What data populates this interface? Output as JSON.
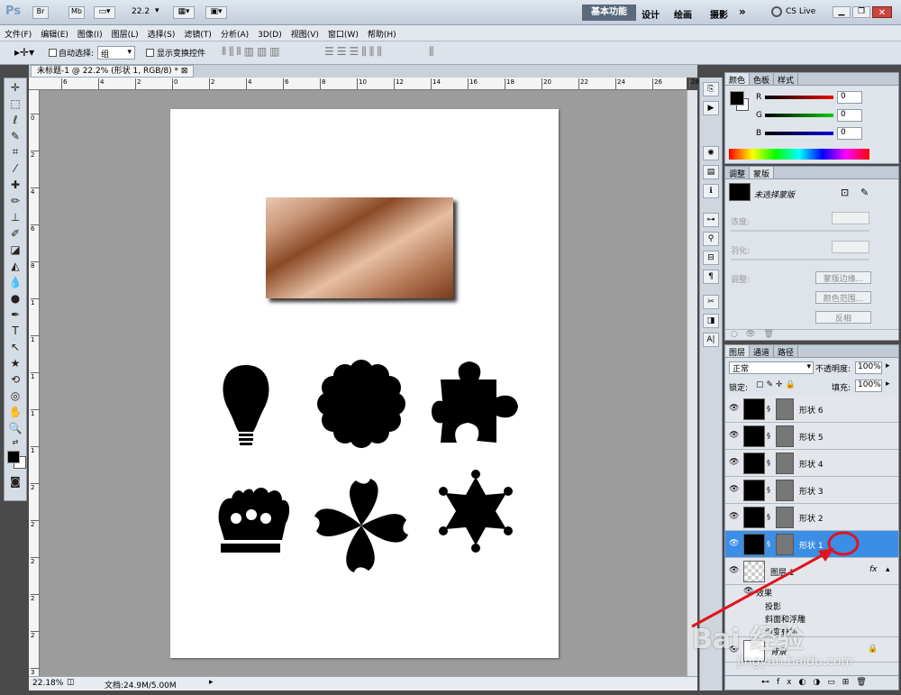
{
  "app": {
    "logo": "Ps",
    "bridge": "Br",
    "minibridge": "Mb",
    "zoom": "22.2",
    "workspaces": [
      "基本功能",
      "设计",
      "绘画",
      "摄影"
    ],
    "more": "»",
    "cslive": "CS Live"
  },
  "menu": [
    "文件(F)",
    "编辑(E)",
    "图像(I)",
    "图层(L)",
    "选择(S)",
    "滤镜(T)",
    "分析(A)",
    "3D(D)",
    "视图(V)",
    "窗口(W)",
    "帮助(H)"
  ],
  "options": {
    "autoselect_label": "自动选择:",
    "autoselect_value": "组",
    "transform_label": "显示变换控件"
  },
  "document": {
    "tab_title": "未标题-1 @ 22.2% (形状 1, RGB/8) *",
    "status_zoom": "22.18%",
    "status_doc": "文档:24.9M/5.00M",
    "ruler_top": [
      "6",
      "4",
      "2",
      "0",
      "2",
      "4",
      "6",
      "8",
      "10",
      "12",
      "14",
      "16",
      "18",
      "20",
      "22",
      "24",
      "26",
      "28"
    ],
    "ruler_left": [
      "0",
      "2",
      "4",
      "6",
      "8",
      "1",
      "1",
      "1",
      "1",
      "1",
      "2",
      "2",
      "2",
      "2",
      "2",
      "3"
    ]
  },
  "color_panel": {
    "tabs": [
      "颜色",
      "色板",
      "样式"
    ],
    "r_label": "R",
    "r_value": "0",
    "g_label": "G",
    "g_value": "0",
    "b_label": "B",
    "b_value": "0"
  },
  "adjust_panel": {
    "tabs": [
      "调整",
      "蒙版"
    ],
    "no_mask": "未选择蒙版",
    "density": "浓度:",
    "feather": "羽化:",
    "refine": "调整:",
    "mask_edge": "蒙版边缘...",
    "color_range": "颜色范围...",
    "invert": "反相"
  },
  "layers_panel": {
    "tabs": [
      "图层",
      "通道",
      "路径"
    ],
    "blend": "正常",
    "opacity_label": "不透明度:",
    "opacity": "100%",
    "lock_label": "锁定:",
    "fill_label": "填充:",
    "fill": "100%",
    "layers": [
      {
        "name": "形状 6",
        "selected": false
      },
      {
        "name": "形状 5",
        "selected": false
      },
      {
        "name": "形状 4",
        "selected": false
      },
      {
        "name": "形状 3",
        "selected": false
      },
      {
        "name": "形状 2",
        "selected": false
      },
      {
        "name": "形状 1",
        "selected": true
      }
    ],
    "layer1": "图层 1",
    "fx": "fx",
    "effects": "效果",
    "effect1": "投影",
    "effect2": "斜面和浮雕",
    "effect3": "渐变叠加",
    "background": "背景"
  },
  "watermark": {
    "text": "Bai 经验",
    "url": "jingyan.baidu.com"
  },
  "colors": {
    "accent_blue": "#3a8ee6",
    "annotation_red": "#e0141e"
  }
}
